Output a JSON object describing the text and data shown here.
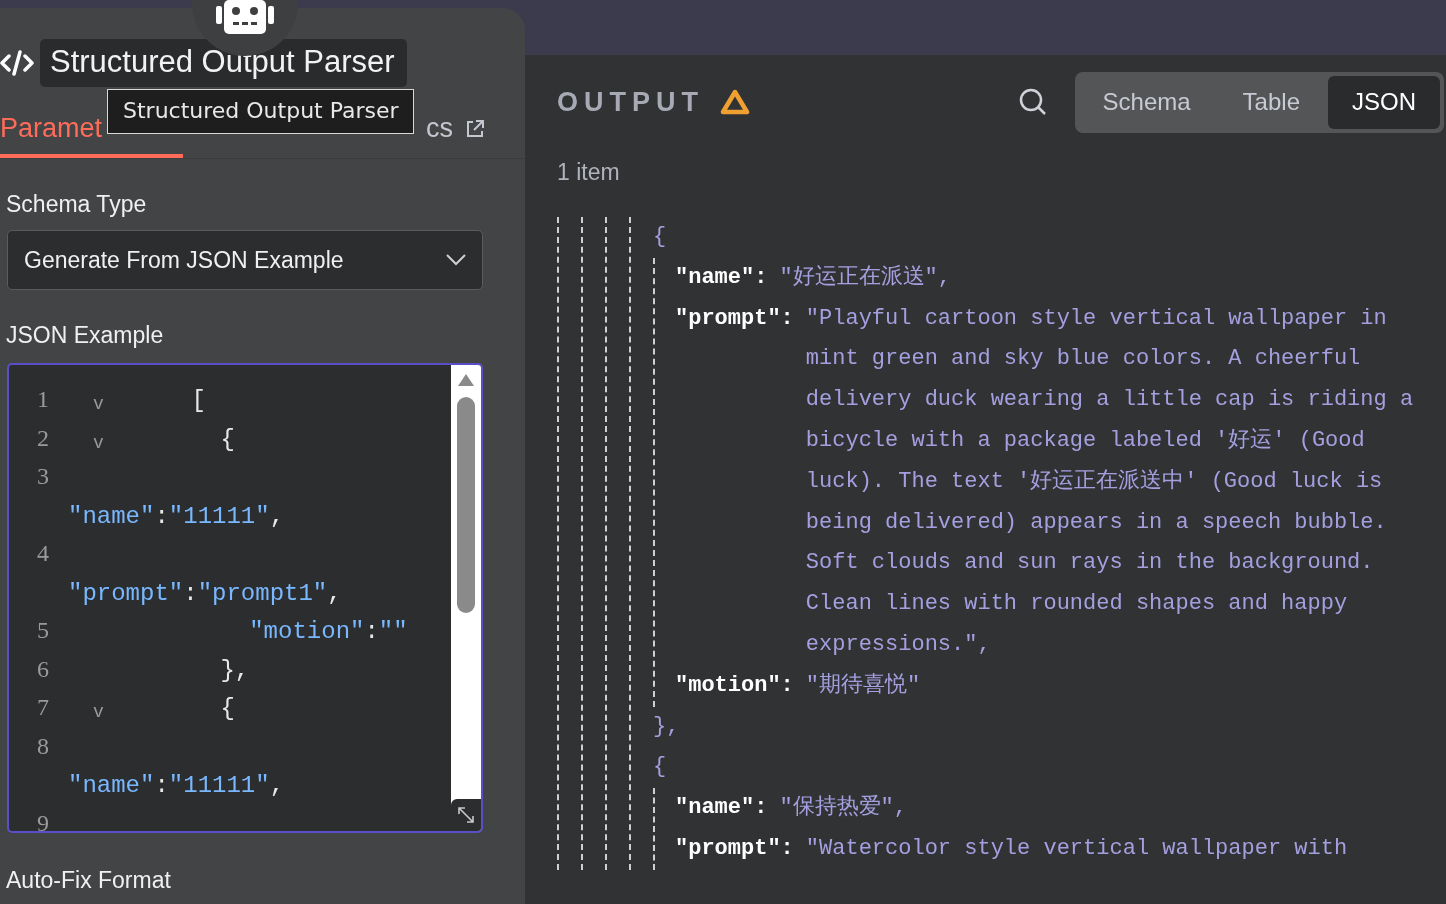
{
  "node": {
    "title": "Structured Output Parser",
    "tooltip": "Structured Output Parser"
  },
  "tabs": [
    {
      "label": "Paramet",
      "selected": true,
      "external": false
    },
    {
      "label": "cs",
      "selected": false,
      "external": true
    }
  ],
  "schema_type": {
    "label": "Schema Type",
    "value": "Generate From JSON Example"
  },
  "json_example": {
    "label": "JSON Example",
    "lines": [
      {
        "number": "1",
        "fold": "v",
        "wrapped": false,
        "tokens": [
          {
            "kind": "punct",
            "text": "    ["
          }
        ]
      },
      {
        "number": "2",
        "fold": "v",
        "wrapped": false,
        "tokens": [
          {
            "kind": "punct",
            "text": "      {"
          }
        ]
      },
      {
        "number": "3",
        "wrapped": true,
        "tokens": [
          {
            "kind": "string",
            "text": "\"name\""
          },
          {
            "kind": "punct",
            "text": ":"
          },
          {
            "kind": "string",
            "text": "\"11111\""
          },
          {
            "kind": "punct",
            "text": ","
          }
        ]
      },
      {
        "number": "4",
        "wrapped": true,
        "tokens": [
          {
            "kind": "string",
            "text": "\"prompt\""
          },
          {
            "kind": "punct",
            "text": ":"
          },
          {
            "kind": "string",
            "text": "\"prompt1\""
          },
          {
            "kind": "punct",
            "text": ","
          }
        ]
      },
      {
        "number": "5",
        "wrapped": false,
        "tokens": [
          {
            "kind": "string",
            "text": "        \"motion\""
          },
          {
            "kind": "punct",
            "text": ":"
          },
          {
            "kind": "string",
            "text": "\"\""
          }
        ]
      },
      {
        "number": "6",
        "wrapped": false,
        "tokens": [
          {
            "kind": "punct",
            "text": "      },"
          }
        ]
      },
      {
        "number": "7",
        "fold": "v",
        "wrapped": false,
        "tokens": [
          {
            "kind": "punct",
            "text": "      {"
          }
        ]
      },
      {
        "number": "8",
        "wrapped": true,
        "tokens": [
          {
            "kind": "string",
            "text": "\"name\""
          },
          {
            "kind": "punct",
            "text": ":"
          },
          {
            "kind": "string",
            "text": "\"11111\""
          },
          {
            "kind": "punct",
            "text": ","
          }
        ]
      },
      {
        "number": "9",
        "wrapped": false
      }
    ]
  },
  "auto_fix": {
    "label": "Auto-Fix Format"
  },
  "output": {
    "title": "OUTPUT",
    "warning": true,
    "count": "1 item",
    "views": [
      {
        "label": "Schema",
        "selected": false
      },
      {
        "label": "Table",
        "selected": false
      },
      {
        "label": "JSON",
        "selected": true
      }
    ],
    "lines": [
      {
        "kind": "brace",
        "text": "{"
      },
      {
        "kind": "field",
        "key": "\"name\":",
        "value_lines": [
          "\"好运正在派送\","
        ]
      },
      {
        "kind": "field",
        "key": "\"prompt\":",
        "value_lines": [
          "\"Playful cartoon style vertical wallpaper in",
          "mint green and sky blue colors. A cheerful",
          "delivery duck wearing a little cap is riding a",
          "bicycle with a package labeled '好运' (Good",
          "luck). The text '好运正在派送中' (Good luck is",
          "being delivered) appears in a speech bubble.",
          "Soft clouds and sun rays in the background.",
          "Clean lines with rounded shapes and happy",
          "expressions.\","
        ]
      },
      {
        "kind": "field",
        "key": "\"motion\":",
        "value_lines": [
          "\"期待喜悦\""
        ]
      },
      {
        "kind": "brace",
        "text": "},"
      },
      {
        "kind": "brace",
        "text": "{"
      },
      {
        "kind": "field",
        "key": "\"name\":",
        "value_lines": [
          "\"保持热爱\","
        ]
      },
      {
        "kind": "field",
        "key": "\"prompt\":",
        "value_lines": [
          "\"Watercolor style vertical wallpaper with"
        ]
      }
    ]
  }
}
